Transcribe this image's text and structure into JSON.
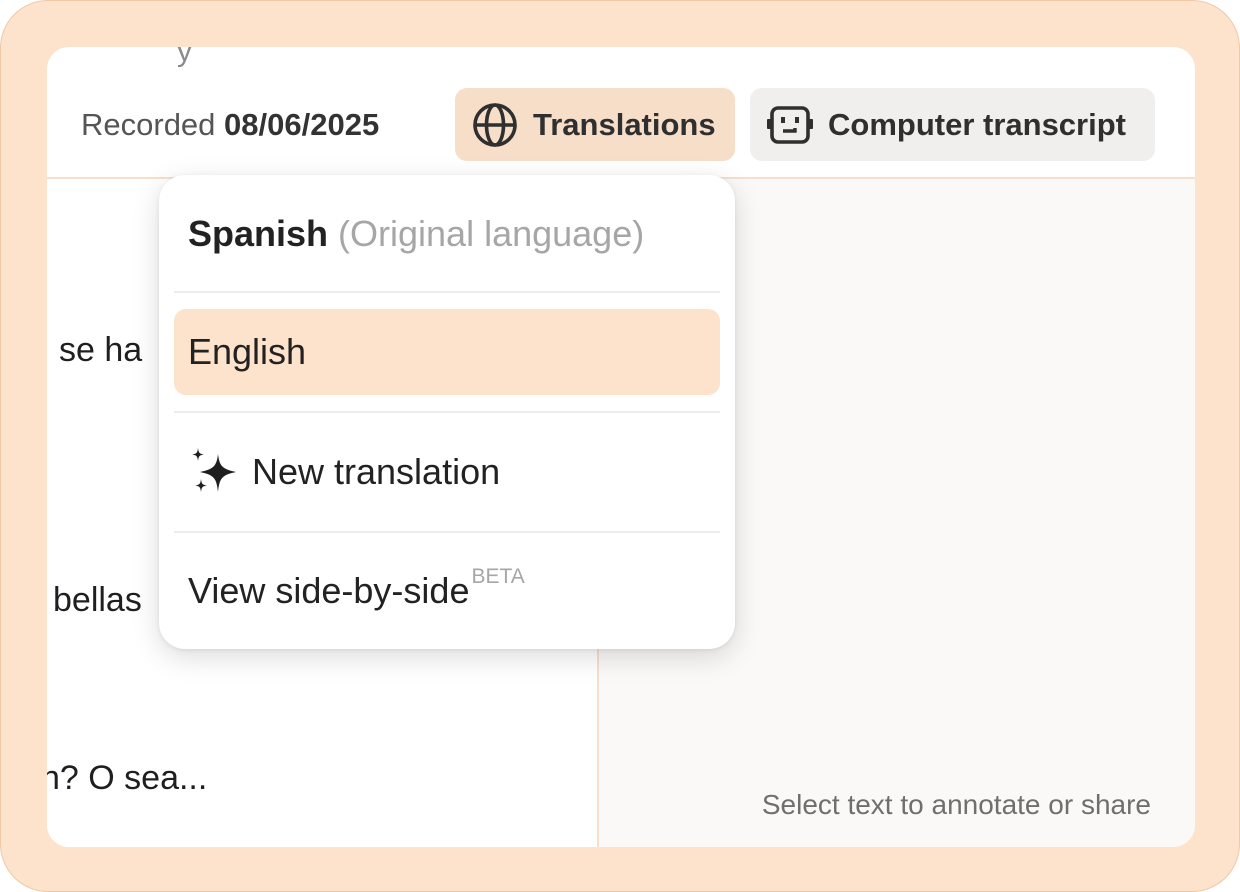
{
  "header": {
    "cut_text": "y",
    "recorded_label": "Recorded",
    "recorded_date": "08/06/2025"
  },
  "toolbar": {
    "translations_label": "Translations",
    "computer_transcript_label": "Computer transcript"
  },
  "transcript": {
    "snippets": [
      "se ha",
      "bellas",
      "n? O sea..."
    ]
  },
  "side_panel": {
    "hint": "Select text to annotate or share"
  },
  "dropdown": {
    "original": {
      "language": "Spanish",
      "note": "(Original language)"
    },
    "selected_language": "English",
    "new_translation_label": "New translation",
    "side_by_side_label": "View side-by-side",
    "side_by_side_badge": "BETA"
  },
  "icons": {
    "translations": "globe-icon",
    "computer_transcript": "robot-icon",
    "new_translation": "sparkles-icon"
  },
  "colors": {
    "frame_bg": "#fde3cb",
    "active_button_bg": "#f6dec8",
    "selected_item_bg": "#fde3cb",
    "inactive_button_bg": "#f0efee"
  }
}
